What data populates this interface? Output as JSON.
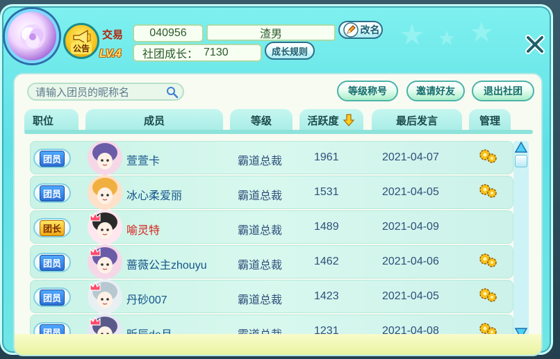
{
  "header": {
    "notice_label": "公告",
    "trade_label": "交易",
    "level_label": "LV.4",
    "club_id": "040956",
    "club_name": "渣男",
    "rename_label": "改名",
    "growth_label": "社团成长：",
    "growth_value": "7130",
    "rules_label": "成长规则"
  },
  "toolbar": {
    "search_placeholder": "请输入团员的昵称名",
    "rank_title_label": "等级称号",
    "invite_label": "邀请好友",
    "quit_label": "退出社团"
  },
  "columns": {
    "position": "职位",
    "member": "成员",
    "level": "等级",
    "activity": "活跃度",
    "last_post": "最后发言",
    "manage": "管理"
  },
  "members": [
    {
      "position": "团员",
      "name": "萱萱卡",
      "level": "霸道总裁",
      "activity": "1961",
      "last_post": "2021-04-07",
      "manage": true,
      "crown": false,
      "leader": false
    },
    {
      "position": "团员",
      "name": "冰心柔爱丽",
      "level": "霸道总裁",
      "activity": "1531",
      "last_post": "2021-04-05",
      "manage": true,
      "crown": false,
      "leader": false
    },
    {
      "position": "团长",
      "name": "喻灵特",
      "level": "霸道总裁",
      "activity": "1489",
      "last_post": "2021-04-09",
      "manage": false,
      "crown": true,
      "leader": true
    },
    {
      "position": "团员",
      "name": "蔷薇公主zhouyu",
      "level": "霸道总裁",
      "activity": "1462",
      "last_post": "2021-04-06",
      "manage": true,
      "crown": true,
      "leader": false
    },
    {
      "position": "团员",
      "name": "丹砂007",
      "level": "霸道总裁",
      "activity": "1423",
      "last_post": "2021-04-05",
      "manage": true,
      "crown": true,
      "leader": false
    },
    {
      "position": "团员",
      "name": "昕辰de月",
      "level": "霸道总裁",
      "activity": "1231",
      "last_post": "2021-04-08",
      "manage": true,
      "crown": true,
      "leader": false
    }
  ],
  "colors": {
    "panel": "#6fe6e6",
    "leader_name": "#d8231e",
    "member_name": "#15558a",
    "badge_member": "#2c6fd6",
    "badge_leader": "#f0a916"
  }
}
